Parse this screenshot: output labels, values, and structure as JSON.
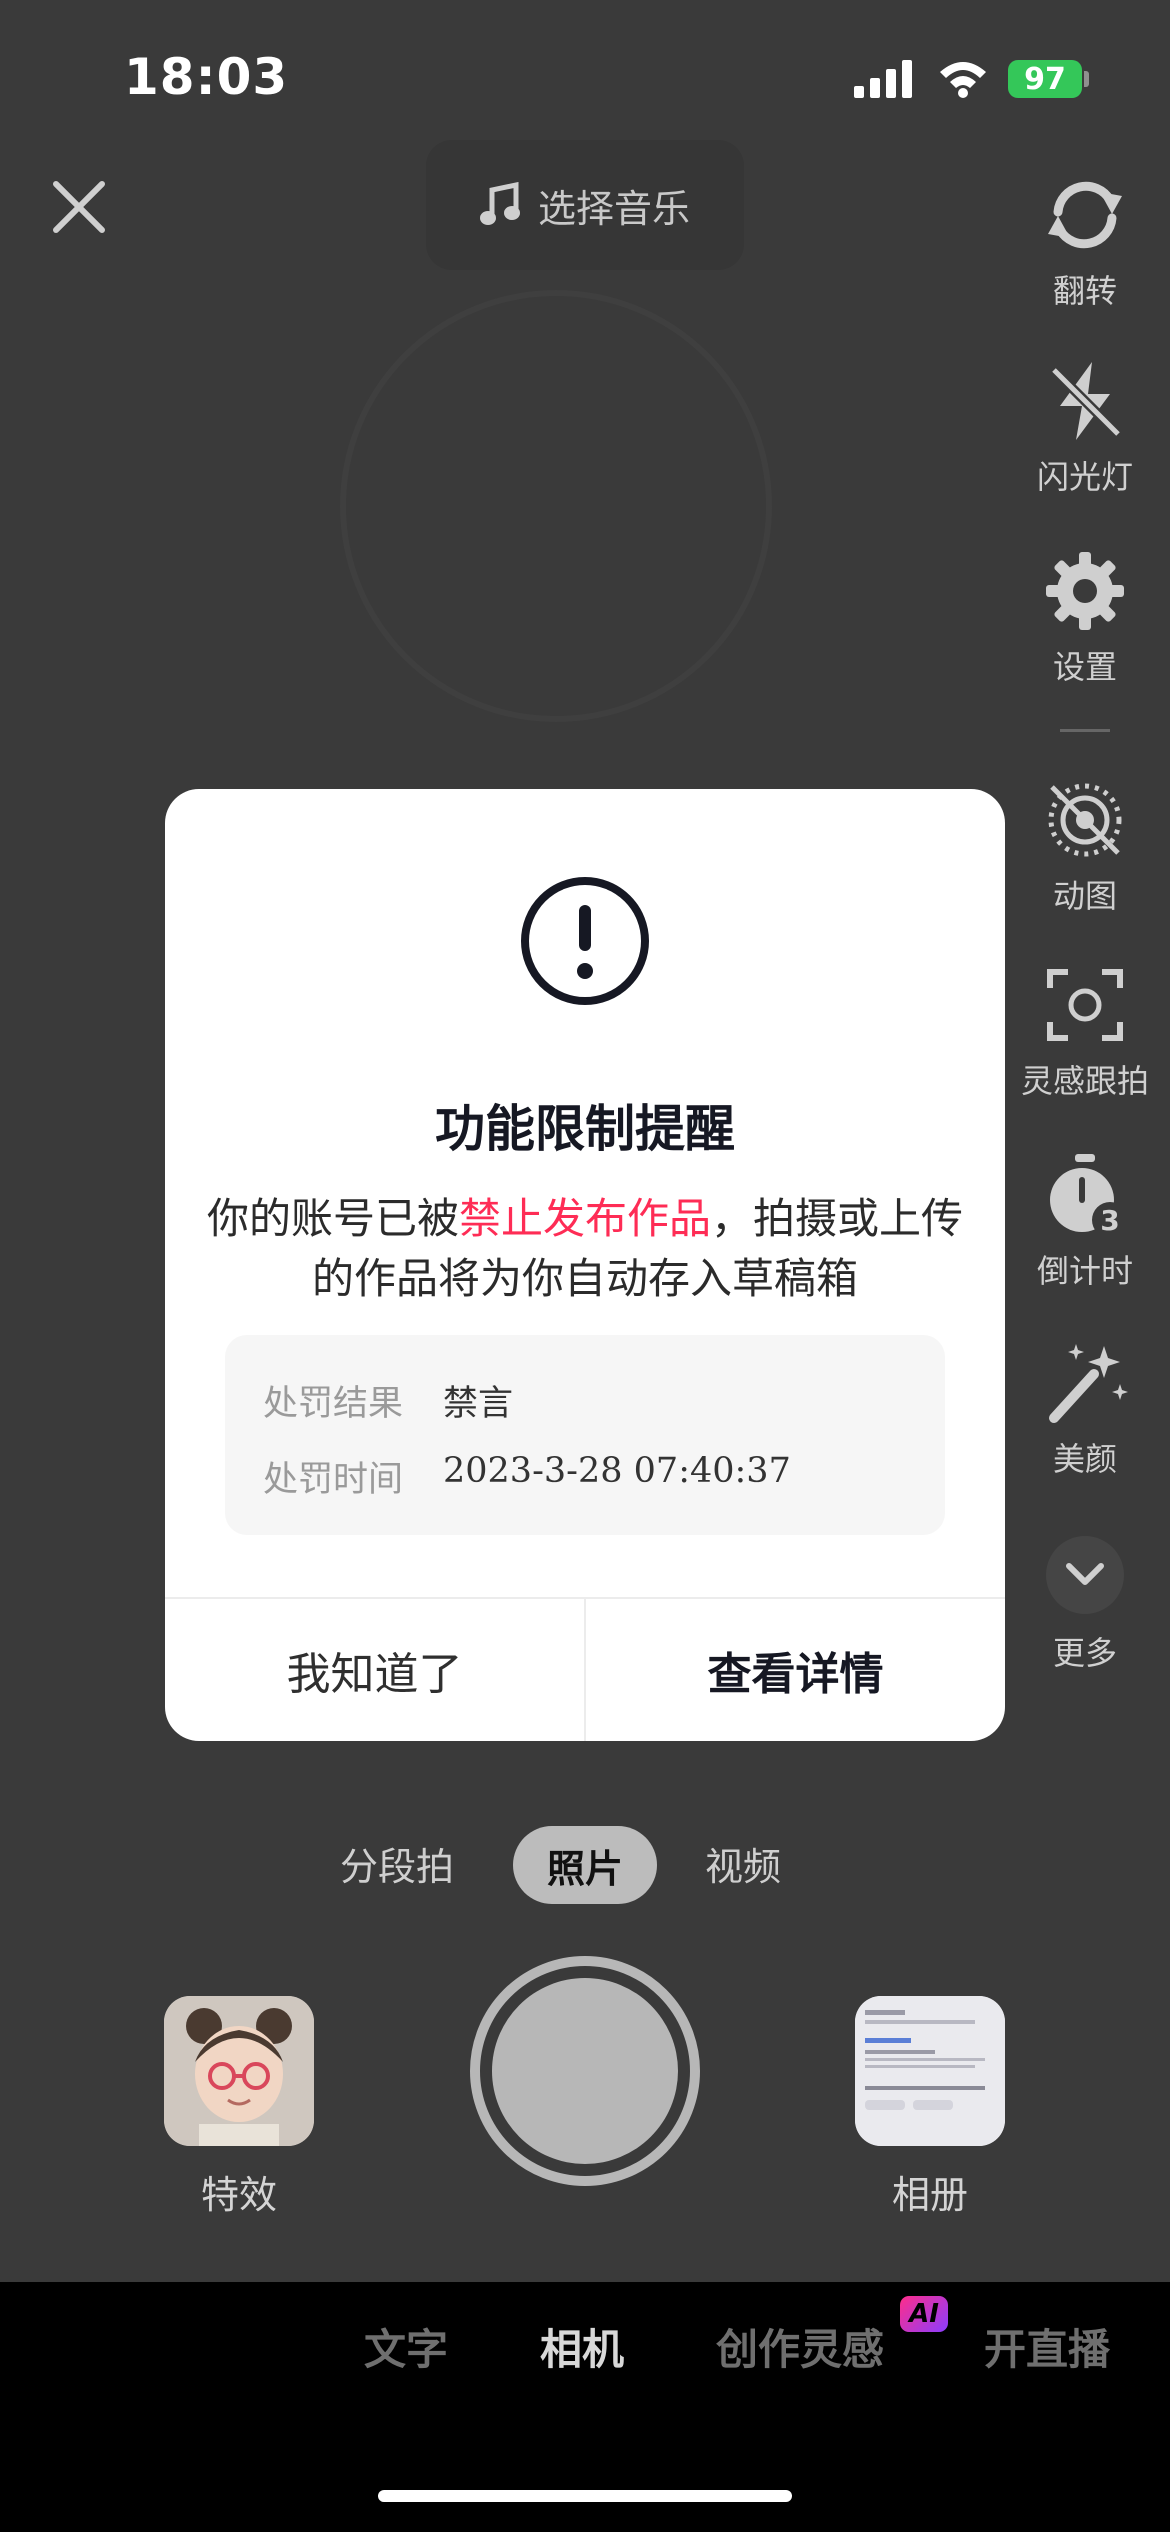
{
  "status_bar": {
    "time": "18:03",
    "battery": "97"
  },
  "top_bar": {
    "music_label": "选择音乐"
  },
  "right_rail": [
    {
      "label": "翻转",
      "icon": "flip-camera-icon"
    },
    {
      "label": "闪光灯",
      "icon": "flash-off-icon"
    },
    {
      "label": "设置",
      "icon": "settings-gear-icon"
    },
    {
      "label": "动图",
      "icon": "live-photo-off-icon"
    },
    {
      "label": "灵感跟拍",
      "icon": "inspiration-track-icon"
    },
    {
      "label": "倒计时",
      "icon": "timer-3-icon"
    },
    {
      "label": "美颜",
      "icon": "beauty-wand-icon"
    },
    {
      "label": "更多",
      "icon": "chevron-down-icon"
    }
  ],
  "modal": {
    "icon": "exclamation-circle-icon",
    "title": "功能限制提醒",
    "desc_prefix": "你的账号已被",
    "desc_highlight": "禁止发布作品",
    "desc_suffix": "，拍摄或上传的作品将为你自动存入草稿箱",
    "result_label": "处罚结果",
    "result_value": "禁言",
    "time_label": "处罚时间",
    "time_value": "2023-3-28 07:40:37",
    "dismiss_button": "我知道了",
    "details_button": "查看详情"
  },
  "modes": {
    "segment": "分段拍",
    "photo": "照片",
    "video": "视频"
  },
  "camera": {
    "effects_label": "特效",
    "album_label": "相册"
  },
  "bottom_nav": {
    "text": "文字",
    "camera": "相机",
    "inspiration": "创作灵感",
    "ai_badge": "AI",
    "live": "开直播"
  },
  "colors": {
    "highlight": "#fe2c55",
    "battery": "#34c759",
    "modal_bg": "#ffffff"
  }
}
